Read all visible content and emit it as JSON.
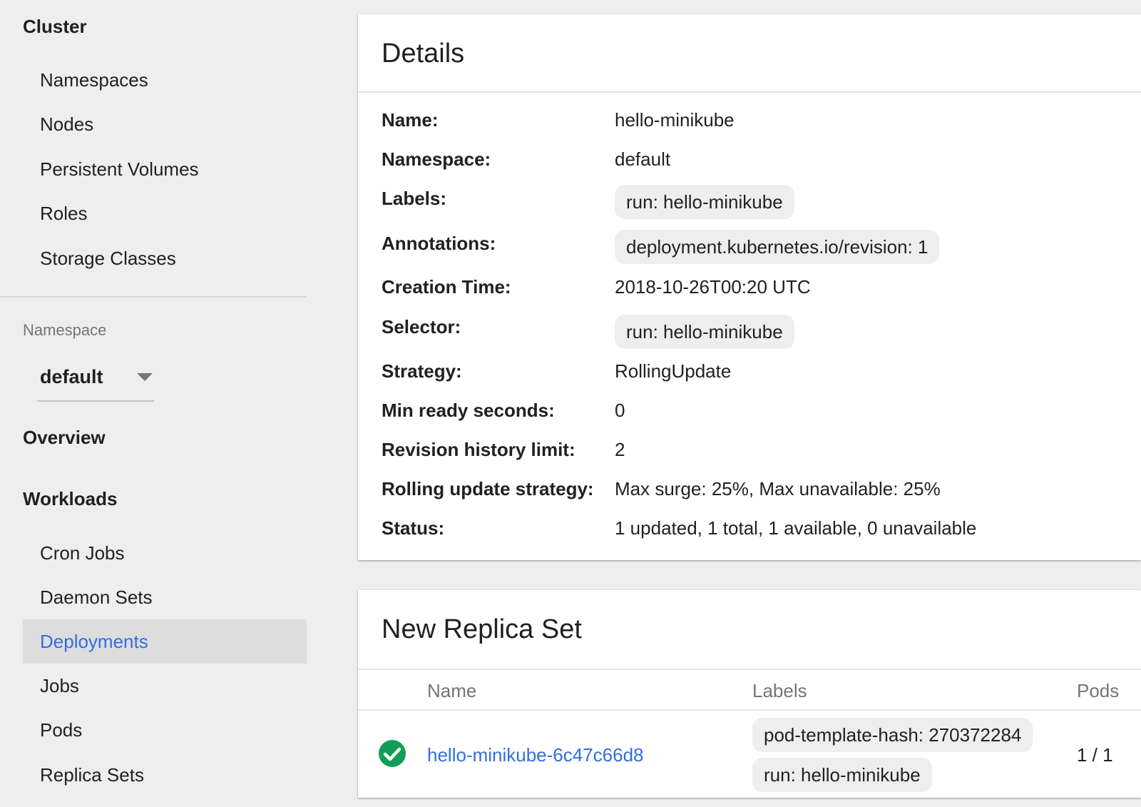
{
  "sidebar": {
    "cluster": {
      "title": "Cluster",
      "items": [
        "Namespaces",
        "Nodes",
        "Persistent Volumes",
        "Roles",
        "Storage Classes"
      ]
    },
    "namespace": {
      "label": "Namespace",
      "selected": "default"
    },
    "overview": {
      "title": "Overview"
    },
    "workloads": {
      "title": "Workloads",
      "items": [
        "Cron Jobs",
        "Daemon Sets",
        "Deployments",
        "Jobs",
        "Pods",
        "Replica Sets"
      ],
      "active": "Deployments"
    }
  },
  "details": {
    "title": "Details",
    "rows": [
      {
        "key": "Name:",
        "value": "hello-minikube"
      },
      {
        "key": "Namespace:",
        "value": "default"
      },
      {
        "key": "Labels:",
        "chip": "run: hello-minikube"
      },
      {
        "key": "Annotations:",
        "chip": "deployment.kubernetes.io/revision:  1"
      },
      {
        "key": "Creation Time:",
        "value": "2018-10-26T00:20 UTC"
      },
      {
        "key": "Selector:",
        "chip": "run: hello-minikube"
      },
      {
        "key": "Strategy:",
        "value": "RollingUpdate"
      },
      {
        "key": "Min ready seconds:",
        "value": "0"
      },
      {
        "key": "Revision history limit:",
        "value": "2"
      },
      {
        "key": "Rolling update strategy:",
        "value": "Max surge: 25%, Max unavailable: 25%"
      },
      {
        "key": "Status:",
        "value": "1 updated, 1 total, 1 available, 0 unavailable"
      }
    ]
  },
  "replica_set": {
    "title": "New Replica Set",
    "columns": [
      "Name",
      "Labels",
      "Pods"
    ],
    "rows": [
      {
        "status": "success",
        "name": "hello-minikube-6c47c66d8",
        "labels": [
          "pod-template-hash: 270372284",
          "run: hello-minikube"
        ],
        "pods": "1 / 1"
      }
    ]
  },
  "colors": {
    "accent": "#326de6",
    "success": "#0f9d58",
    "background": "#eeeeee"
  },
  "icons": {
    "status": "check-circle-icon",
    "dropdown": "caret-down-icon"
  }
}
